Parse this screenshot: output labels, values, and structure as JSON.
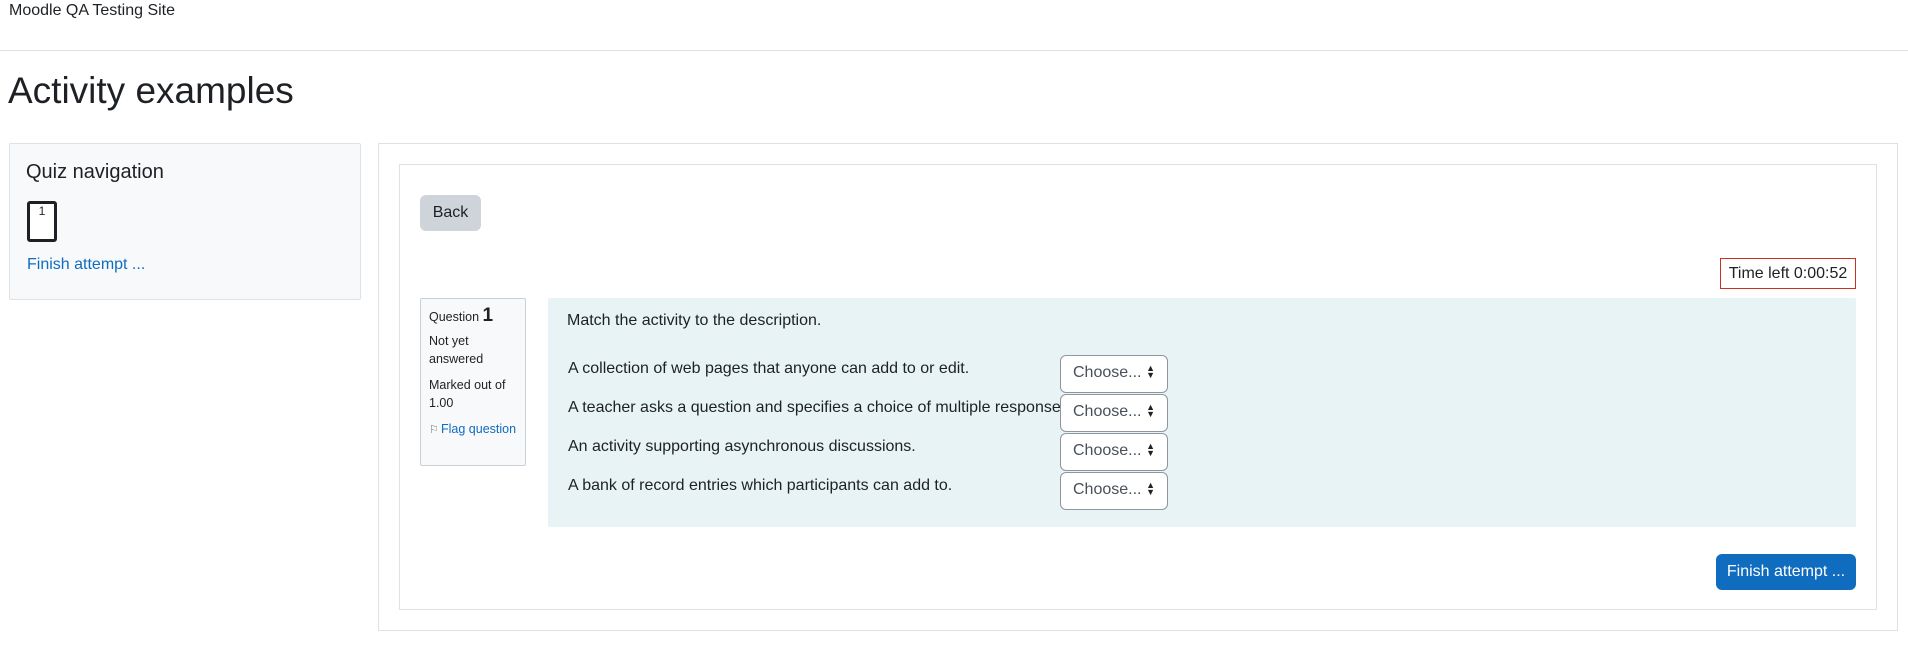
{
  "site": {
    "name": "Moodle QA Testing Site"
  },
  "page": {
    "title": "Activity examples"
  },
  "quiz_nav": {
    "title": "Quiz navigation",
    "question_button": "1",
    "finish_link": "Finish attempt ..."
  },
  "content": {
    "back_label": "Back",
    "timer": "Time left 0:00:52",
    "finish_label": "Finish attempt ..."
  },
  "question": {
    "prefix": "Question",
    "number": "1",
    "state": "Not yet answered",
    "grade": "Marked out of 1.00",
    "flag_label": "Flag question",
    "flag_icon": "flag-icon",
    "text": "Match the activity to the description.",
    "rows": [
      {
        "label": "A collection of web pages that anyone can add to or edit.",
        "select": "Choose..."
      },
      {
        "label": "A teacher asks a question and specifies a choice of multiple responses.",
        "select": "Choose..."
      },
      {
        "label": "An activity supporting asynchronous discussions.",
        "select": "Choose..."
      },
      {
        "label": "A bank of record entries which participants can add to.",
        "select": "Choose..."
      }
    ]
  },
  "colors": {
    "link": "#0f6cbf",
    "primary_button": "#0f6cbf",
    "secondary_button": "#ced4da",
    "timer_border": "#ca3120",
    "question_bg": "#e7f3f5"
  }
}
